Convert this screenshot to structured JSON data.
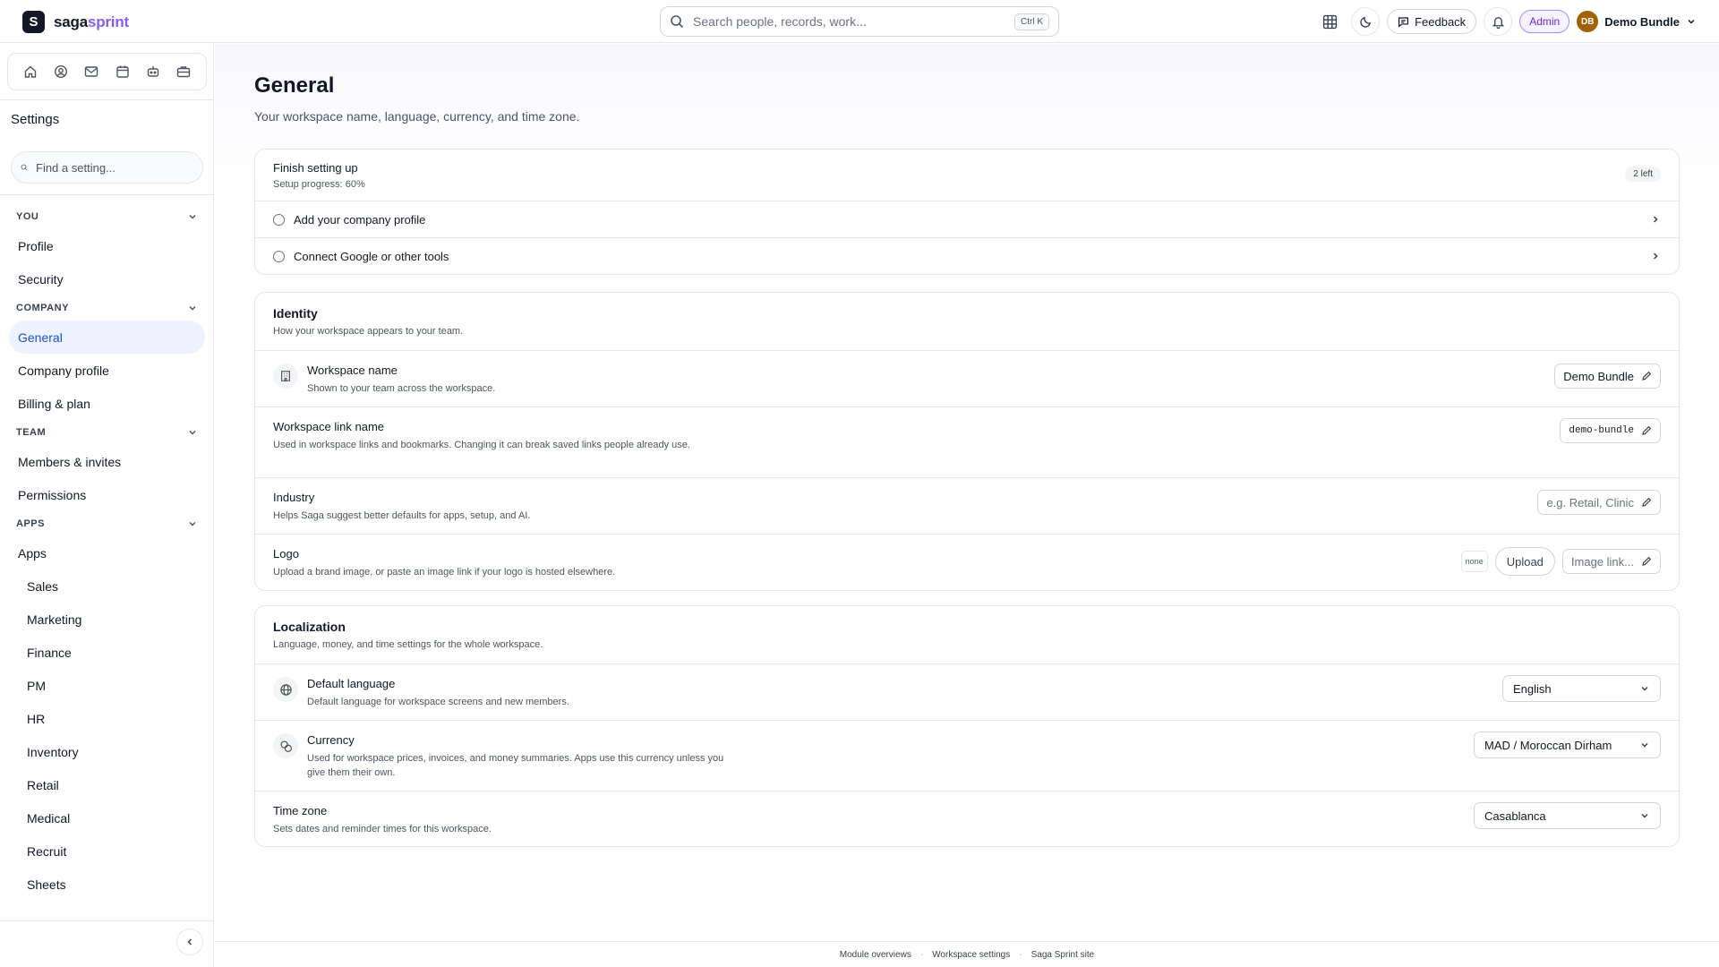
{
  "brand": {
    "mark": "S",
    "name_primary": "saga",
    "name_accent": "sprint"
  },
  "search": {
    "placeholder": "Search people, records, work...",
    "shortcut": "Ctrl K"
  },
  "topbar": {
    "feedback_label": "Feedback",
    "admin_label": "Admin",
    "user_initials": "DB",
    "user_name": "Demo Bundle"
  },
  "sidebar": {
    "title": "Settings",
    "search_placeholder": "Find a setting...",
    "sections": {
      "you": "YOU",
      "company": "COMPANY",
      "team": "TEAM",
      "apps": "APPS"
    },
    "items": {
      "profile": "Profile",
      "security": "Security",
      "general": "General",
      "company_profile": "Company profile",
      "billing": "Billing & plan",
      "members": "Members & invites",
      "permissions": "Permissions",
      "apps": "Apps",
      "sales": "Sales",
      "marketing": "Marketing",
      "finance": "Finance",
      "pm": "PM",
      "hr": "HR",
      "inventory": "Inventory",
      "retail": "Retail",
      "medical": "Medical",
      "recruit": "Recruit",
      "sheets": "Sheets"
    }
  },
  "page": {
    "title": "General",
    "subtitle": "Your workspace name, language, currency, and time zone."
  },
  "setup": {
    "title": "Finish setting up",
    "progress_text": "Setup progress: 60%",
    "progress": 0.6,
    "remaining_badge": "2 left",
    "tasks": [
      "Add your company profile",
      "Connect Google or other tools"
    ]
  },
  "identity": {
    "title": "Identity",
    "subtitle": "How your workspace appears to your team.",
    "workspace_name": {
      "label": "Workspace name",
      "desc": "Shown to your team across the workspace.",
      "value": "Demo Bundle"
    },
    "link_name": {
      "label": "Workspace link name",
      "desc": "Used in workspace links and bookmarks. Changing it can break saved links people already use.",
      "value": "demo-bundle"
    },
    "industry": {
      "label": "Industry",
      "desc": "Helps Saga suggest better defaults for apps, setup, and AI.",
      "placeholder": "e.g. Retail, Clinic"
    },
    "logo": {
      "label": "Logo",
      "desc": "Upload a brand image, or paste an image link if your logo is hosted elsewhere.",
      "preview": "none",
      "upload_label": "Upload",
      "link_placeholder": "Image link..."
    }
  },
  "localization": {
    "title": "Localization",
    "subtitle": "Language, money, and time settings for the whole workspace.",
    "language": {
      "label": "Default language",
      "desc": "Default language for workspace screens and new members.",
      "value": "English"
    },
    "currency": {
      "label": "Currency",
      "desc": "Used for workspace prices, invoices, and money summaries. Apps use this currency unless you give them their own.",
      "value": "MAD / Moroccan Dirham"
    },
    "timezone": {
      "label": "Time zone",
      "desc": "Sets dates and reminder times for this workspace.",
      "value": "Casablanca"
    }
  },
  "footer": {
    "links": [
      "Module overviews",
      "Workspace settings",
      "Saga Sprint site"
    ]
  },
  "colors": {
    "accent": "#8b5cf6",
    "active_nav_bg": "#eef2ff",
    "active_nav_text": "#1d4ed8",
    "admin_badge": "#6d28d9"
  },
  "icons": [
    "search-icon",
    "grid-icon",
    "moon-icon",
    "feedback-icon",
    "bell-icon",
    "chevron-down-icon",
    "home-icon",
    "user-circle-icon",
    "mail-icon",
    "calendar-icon",
    "bot-icon",
    "briefcase-icon",
    "building-icon",
    "globe-icon",
    "coins-icon",
    "pencil-icon",
    "chevron-right-icon",
    "chevron-left-icon"
  ]
}
